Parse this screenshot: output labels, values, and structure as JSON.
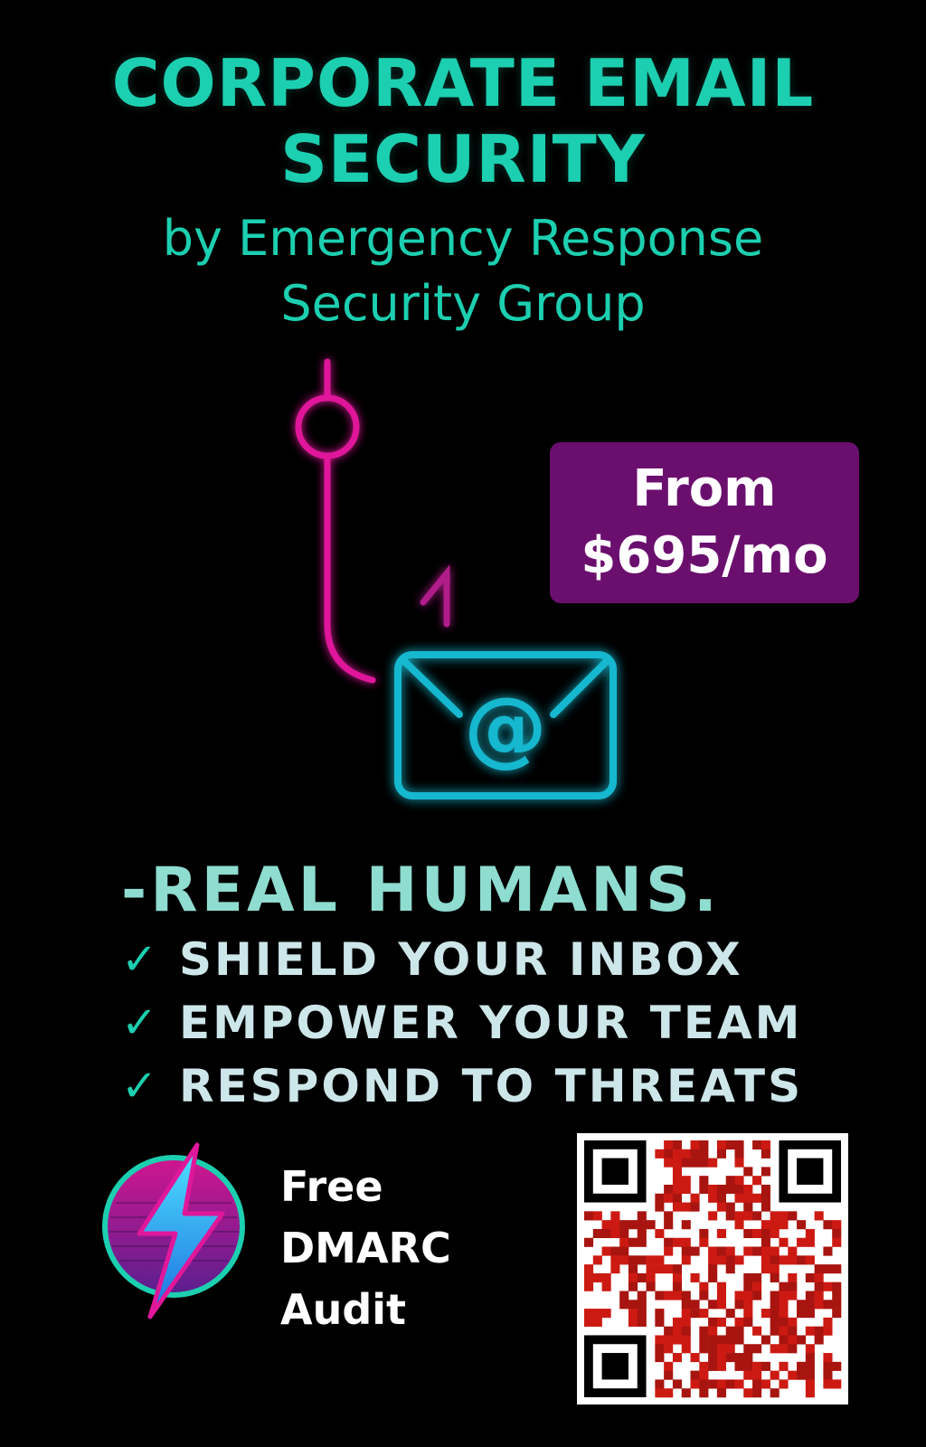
{
  "header": {
    "title": "CORPORATE EMAIL\nSECURITY",
    "subtitle": "by Emergency Response\nSecurity Group"
  },
  "price_badge": {
    "text": "From\n$695/mo"
  },
  "headline": "-REAL HUMANS.",
  "benefits": [
    {
      "check": "✓",
      "label": "SHIELD YOUR INBOX"
    },
    {
      "check": "✓",
      "label": "EMPOWER YOUR TEAM"
    },
    {
      "check": "✓",
      "label": "RESPOND TO THREATS"
    }
  ],
  "cta": {
    "text": "Free\nDMARC\nAudit"
  },
  "icons": {
    "hero": [
      "fishing-hook-icon",
      "envelope-icon",
      "at-sign-icon"
    ],
    "logo": "lightning-bolt-icon",
    "qr": "qr-code-icon"
  },
  "colors": {
    "background": "#000000",
    "teal": "#1ccfb0",
    "magenta": "#e0179a",
    "cyan": "#19b8cf",
    "purple_badge": "#6b0f6e",
    "qr_red": "#cc1a12"
  }
}
